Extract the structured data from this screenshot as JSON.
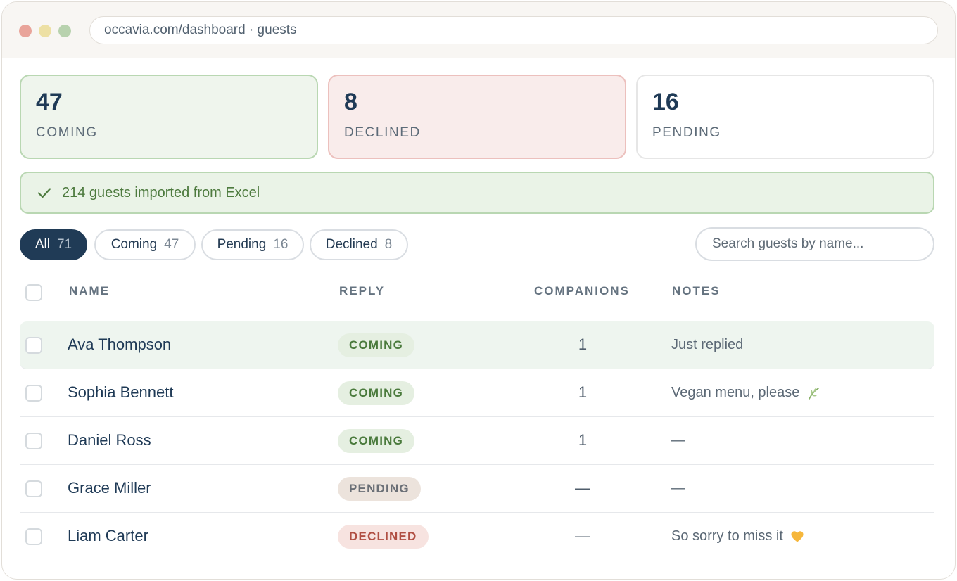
{
  "browser": {
    "url": "occavia.com/dashboard · guests"
  },
  "stats": {
    "coming": {
      "value": "47",
      "label": "COMING"
    },
    "declined": {
      "value": "8",
      "label": "DECLINED"
    },
    "pending": {
      "value": "16",
      "label": "PENDING"
    }
  },
  "toast": {
    "icon": "check-icon",
    "text": "214 guests imported from Excel"
  },
  "filters": [
    {
      "label": "All",
      "count": "71",
      "active": true
    },
    {
      "label": "Coming",
      "count": "47",
      "active": false
    },
    {
      "label": "Pending",
      "count": "16",
      "active": false
    },
    {
      "label": "Declined",
      "count": "8",
      "active": false
    }
  ],
  "search": {
    "placeholder": "Search guests by name..."
  },
  "table": {
    "headers": {
      "name": "NAME",
      "reply": "REPLY",
      "companions": "COMPANIONS",
      "notes": "NOTES"
    },
    "rows": [
      {
        "name": "Ava Thompson",
        "reply": "COMING",
        "companions": "1",
        "notes": "Just replied",
        "note_icon": "",
        "highlighted": true
      },
      {
        "name": "Sophia Bennett",
        "reply": "COMING",
        "companions": "1",
        "notes": "Vegan menu, please",
        "note_icon": "leaf-icon",
        "highlighted": false
      },
      {
        "name": "Daniel Ross",
        "reply": "COMING",
        "companions": "1",
        "notes": "—",
        "note_icon": "",
        "highlighted": false
      },
      {
        "name": "Grace Miller",
        "reply": "PENDING",
        "companions": "—",
        "notes": "—",
        "note_icon": "",
        "highlighted": false
      },
      {
        "name": "Liam Carter",
        "reply": "DECLINED",
        "companions": "—",
        "notes": "So sorry to miss it",
        "note_icon": "heart-icon",
        "highlighted": false
      }
    ]
  },
  "colors": {
    "primary": "#203b56",
    "coming": "#4a7a3c",
    "declined": "#b04f43",
    "pending": "#6a6f76"
  }
}
